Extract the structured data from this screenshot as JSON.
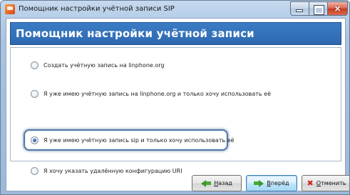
{
  "window": {
    "title": "Помощник настройки учётной записи SIP",
    "controls": {
      "minimize": "minimize",
      "maximize": "maximize",
      "close": "×"
    }
  },
  "header": {
    "title": "Помощник настройки учётной записи"
  },
  "options": [
    {
      "label": "Создать учётную запись на linphone.org",
      "checked": false
    },
    {
      "label": "Я уже имею учётную запись на linphone.org и только хочу использовать её",
      "checked": false
    },
    {
      "label": "Я уже имею учётную запись sip и только хочу использовать её",
      "checked": true
    },
    {
      "label": "Я хочу указать удалённую конфигурацию URI",
      "checked": false
    }
  ],
  "buttons": {
    "back": {
      "mnemonic": "Н",
      "rest": "азад"
    },
    "next": {
      "mnemonic": "В",
      "rest": "перёд"
    },
    "cancel": {
      "mnemonic": "О",
      "rest": "тменить"
    }
  },
  "icons": {
    "app": "linphone-icon",
    "back": "arrow-left-icon",
    "next": "arrow-right-icon",
    "cancel": "cancel-x-icon"
  },
  "colors": {
    "banner": "#2d69b0",
    "focus": "#5479a8",
    "arrow": "#3c9a2a",
    "cancel": "#c8281c"
  }
}
